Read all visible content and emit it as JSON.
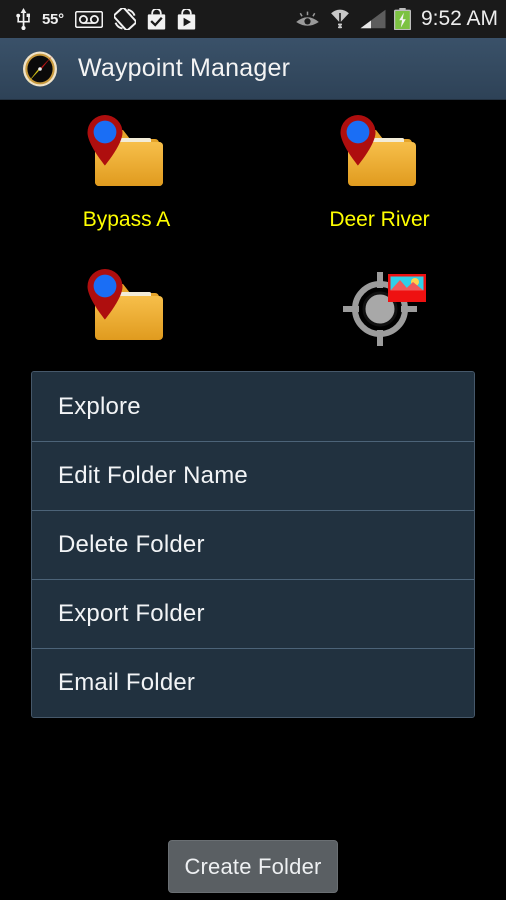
{
  "status_bar": {
    "temperature": "55°",
    "clock": "9:52 AM",
    "left_icons": [
      {
        "name": "usb-icon",
        "label": "USB"
      },
      {
        "name": "temperature-indicator",
        "label": "55°"
      },
      {
        "name": "voicemail-icon",
        "label": "Voicemail"
      },
      {
        "name": "screen-rotation-icon",
        "label": "Auto-rotate"
      },
      {
        "name": "play-store-check-icon",
        "label": "App installed"
      },
      {
        "name": "play-store-download-icon",
        "label": "App downloading"
      }
    ],
    "right_icons": [
      {
        "name": "smart-stay-eye-icon",
        "label": "Smart stay"
      },
      {
        "name": "wifi-icon",
        "label": "Wi-Fi"
      },
      {
        "name": "cellular-signal-icon",
        "label": "Signal"
      },
      {
        "name": "battery-charging-icon",
        "label": "Battery charging"
      }
    ]
  },
  "app_bar": {
    "icon": "compass-icon",
    "title": "Waypoint Manager"
  },
  "grid": {
    "items": [
      {
        "label": "Bypass A",
        "icon": "folder-waypoint-icon",
        "visible_label": true
      },
      {
        "label": "Deer River",
        "icon": "folder-waypoint-icon",
        "visible_label": true
      },
      {
        "label": "",
        "icon": "folder-waypoint-icon",
        "visible_label": false
      },
      {
        "label": "",
        "icon": "crosshair-photo-icon",
        "visible_label": false
      }
    ]
  },
  "dialog": {
    "items": [
      {
        "label": "Explore"
      },
      {
        "label": "Edit Folder Name"
      },
      {
        "label": "Delete Folder"
      },
      {
        "label": "Export Folder"
      },
      {
        "label": "Email Folder"
      }
    ]
  },
  "footer": {
    "create_folder_label": "Create Folder"
  },
  "colors": {
    "app_bar": "#344a60",
    "dialog_bg": "#21313f",
    "dialog_divider": "#4c6378",
    "label_yellow": "#ffff00",
    "folder_gold": "#eeab2c",
    "pin_red": "#b00b0b",
    "pin_blue": "#1a6ef5",
    "button_gray": "#5a5f63",
    "status_bar_bg": "#1a1a1a",
    "screen_bg": "#000000"
  }
}
